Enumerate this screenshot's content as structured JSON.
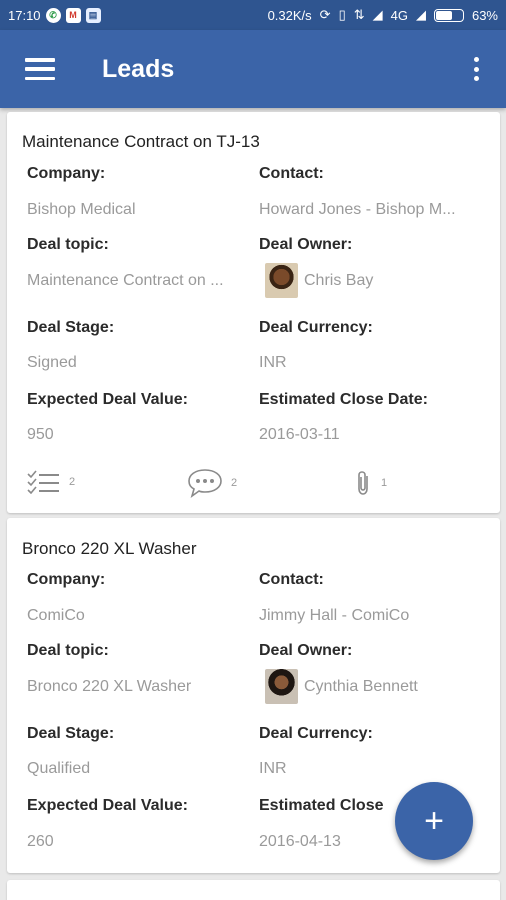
{
  "status_bar": {
    "time": "17:10",
    "notification_icons": [
      "whatsapp-icon",
      "gmail-icon",
      "message-icon"
    ],
    "speed": "0.32K/s",
    "network": "4G",
    "battery": "63%",
    "battery_level": 0.63
  },
  "app_bar": {
    "title": "Leads"
  },
  "leads": [
    {
      "title": "Maintenance Contract on TJ-13",
      "company_label": "Company:",
      "company": "Bishop Medical",
      "contact_label": "Contact:",
      "contact": "Howard Jones - Bishop M...",
      "topic_label": "Deal topic:",
      "topic": "Maintenance Contract on ...",
      "owner_label": "Deal Owner:",
      "owner": "Chris Bay",
      "stage_label": "Deal Stage:",
      "stage": "Signed",
      "currency_label": "Deal Currency:",
      "currency": "INR",
      "value_label": "Expected Deal Value:",
      "value": "950",
      "close_label": "Estimated Close Date:",
      "close_date": "2016-03-11",
      "tasks_count": "2",
      "comments_count": "2",
      "attachments_count": "1"
    },
    {
      "title": "Bronco 220 XL Washer",
      "company_label": "Company:",
      "company": "ComiCo",
      "contact_label": "Contact:",
      "contact": "Jimmy Hall - ComiCo",
      "topic_label": "Deal topic:",
      "topic": "Bronco 220 XL Washer",
      "owner_label": "Deal Owner:",
      "owner": "Cynthia Bennett",
      "stage_label": "Deal Stage:",
      "stage": "Qualified",
      "currency_label": "Deal Currency:",
      "currency": "INR",
      "value_label": "Expected Deal Value:",
      "value": "260",
      "close_label": "Estimated Close",
      "close_date": "2016-04-13"
    }
  ],
  "fab": {
    "label": "+"
  },
  "colors": {
    "primary": "#3b64a8",
    "status_bar": "#2f5590"
  }
}
